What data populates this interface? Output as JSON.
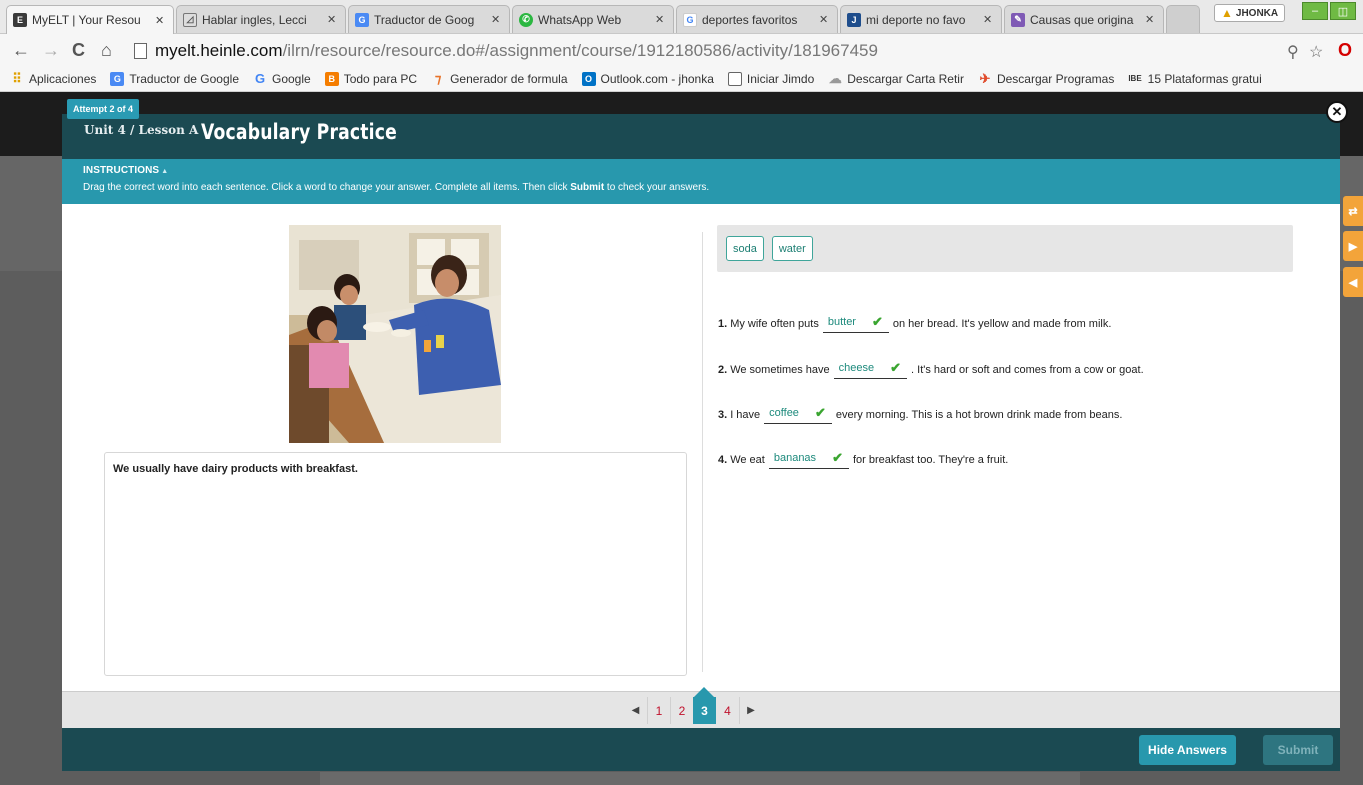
{
  "browser": {
    "tabs": [
      {
        "title": "MyELT | Your Resou",
        "icon": "myelt-icon",
        "color": "#3a3a3a"
      },
      {
        "title": "Hablar ingles, Lecci",
        "icon": "lesson-icon",
        "color": "#4a4a4a"
      },
      {
        "title": "Traductor de Goog",
        "icon": "google-translate-icon",
        "color": "#4a8af4"
      },
      {
        "title": "WhatsApp Web",
        "icon": "whatsapp-icon",
        "color": "#2bb741"
      },
      {
        "title": "deportes favoritos",
        "icon": "google-icon",
        "color": "#4285f4"
      },
      {
        "title": "mi deporte no favo",
        "icon": "doc-icon",
        "color": "#1e4d8c"
      },
      {
        "title": "Causas que origina",
        "icon": "page-icon",
        "color": "#7f5ab5"
      }
    ],
    "profile_name": "JHONKA",
    "url_domain": "myelt.heinle.com",
    "url_path": "/ilrn/resource/resource.do#/assignment/course/1912180586/activity/181967459",
    "bookmarks": [
      {
        "label": "Aplicaciones",
        "icon": "apps-icon",
        "color": "#e0a000"
      },
      {
        "label": "Traductor de Google",
        "icon": "google-translate-icon",
        "color": "#4a8af4"
      },
      {
        "label": "Google",
        "icon": "google-icon",
        "color": "#4285f4"
      },
      {
        "label": "Todo para PC",
        "icon": "blogger-icon",
        "color": "#f57d00"
      },
      {
        "label": "Generador de formula",
        "icon": "formula-icon",
        "color": "#e8732a"
      },
      {
        "label": "Outlook.com - jhonka",
        "icon": "outlook-icon",
        "color": "#0072c6"
      },
      {
        "label": "Iniciar Jimdo",
        "icon": "page-icon",
        "color": "#888888"
      },
      {
        "label": "Descargar Carta Retir",
        "icon": "cloud-icon",
        "color": "#999999"
      },
      {
        "label": "Descargar Programas",
        "icon": "bird-icon",
        "color": "#e04a2a"
      },
      {
        "label": "15 Plataformas gratui",
        "icon": "ibe-icon",
        "color": "#333333"
      }
    ],
    "ibe_label": "IBE"
  },
  "activity": {
    "attempt": "Attempt 2 of 4",
    "unit_lesson": "Unit 4 / Lesson A",
    "title": "Vocabulary Practice",
    "instructions_title": "INSTRUCTIONS",
    "instructions_text_before": "Drag the correct word into each sentence. Click a word to change your answer. Complete all items. Then click ",
    "instructions_text_bold": "Submit",
    "instructions_text_after": " to check your answers.",
    "caption": "We usually have dairy products with breakfast.",
    "word_bank": [
      "soda",
      "water"
    ],
    "sentences": [
      {
        "num": "1.",
        "before": "My wife often puts",
        "answer": "butter",
        "after": "on her bread. It's yellow and made from milk."
      },
      {
        "num": "2.",
        "before": "We sometimes have",
        "answer": "cheese",
        "after": ". It's hard or soft and comes from a cow or goat."
      },
      {
        "num": "3.",
        "before": "I have",
        "answer": "coffee",
        "after": "every morning. This is a hot brown drink made from beans."
      },
      {
        "num": "4.",
        "before": "We eat",
        "answer": "bananas",
        "after": "for breakfast too. They're a fruit."
      }
    ],
    "pages": [
      "1",
      "2",
      "3",
      "4"
    ],
    "current_page": "3",
    "hide_answers_label": "Hide Answers",
    "submit_label": "Submit"
  },
  "colors": {
    "modal_dark": "#1b4a52",
    "accent_teal": "#2898ad",
    "answer_green": "#1d8a7c",
    "check_green": "#3aa530",
    "page_link_red": "#c0112c"
  }
}
